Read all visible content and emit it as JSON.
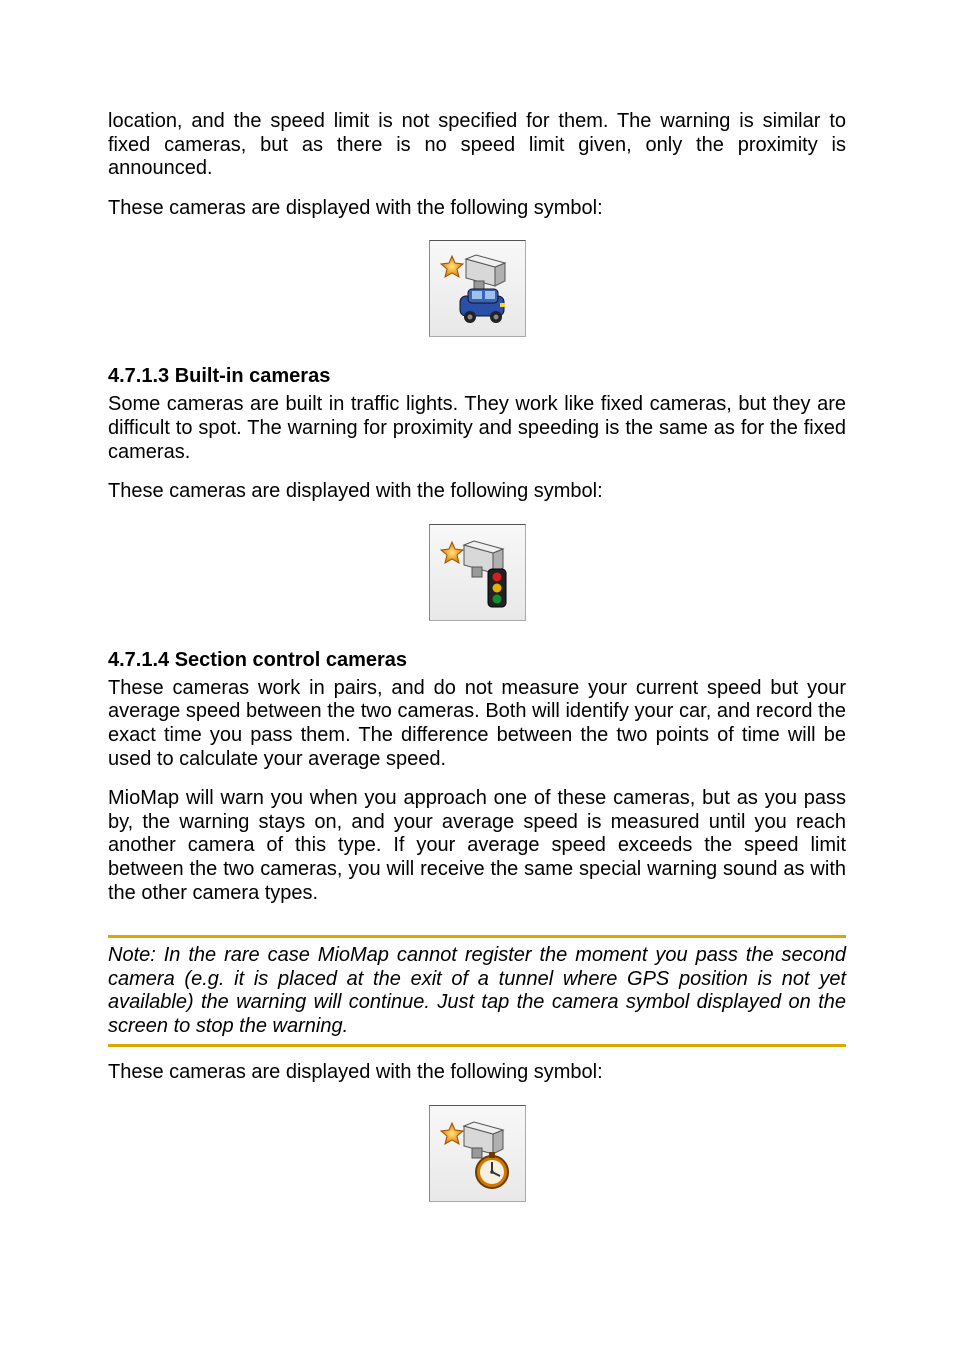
{
  "paragraphs": {
    "top1": "location, and the speed limit is not specified for them. The warning is similar to fixed cameras, but as there is no speed limit given, only the proximity is announced.",
    "top2": "These cameras are displayed with the following symbol:",
    "builtin_heading": "4.7.1.3  Built-in cameras",
    "builtin1": "Some cameras are built in traffic lights. They work like fixed cameras, but they are difficult to spot. The warning for proximity and speeding is the same as for the fixed cameras.",
    "builtin2": "These cameras are displayed with the following symbol:",
    "section_heading": "4.7.1.4  Section control cameras",
    "section1": "These cameras work in pairs, and do not measure your current speed but your average speed between the two cameras. Both will identify your car, and record the exact time you pass them. The difference between the two points of time will be used to calculate your average speed.",
    "section2": "MioMap will warn you when you approach one of these cameras, but as you pass by, the warning stays on, and your average speed is measured until you reach another camera of this type. If your average speed exceeds the speed limit between the two cameras, you will receive the same special warning sound as with the other camera types.",
    "note": "Note: In the rare case MioMap cannot register the moment you pass the second camera (e.g. it is placed at the exit of a tunnel where GPS position is not yet available) the warning will continue. Just tap the camera symbol displayed on the screen to stop the warning.",
    "section3": "These cameras are displayed with the following symbol:"
  },
  "icons": {
    "mobile_camera": "mobile-camera-icon",
    "builtin_camera": "builtin-camera-icon",
    "section_camera": "section-camera-icon"
  }
}
